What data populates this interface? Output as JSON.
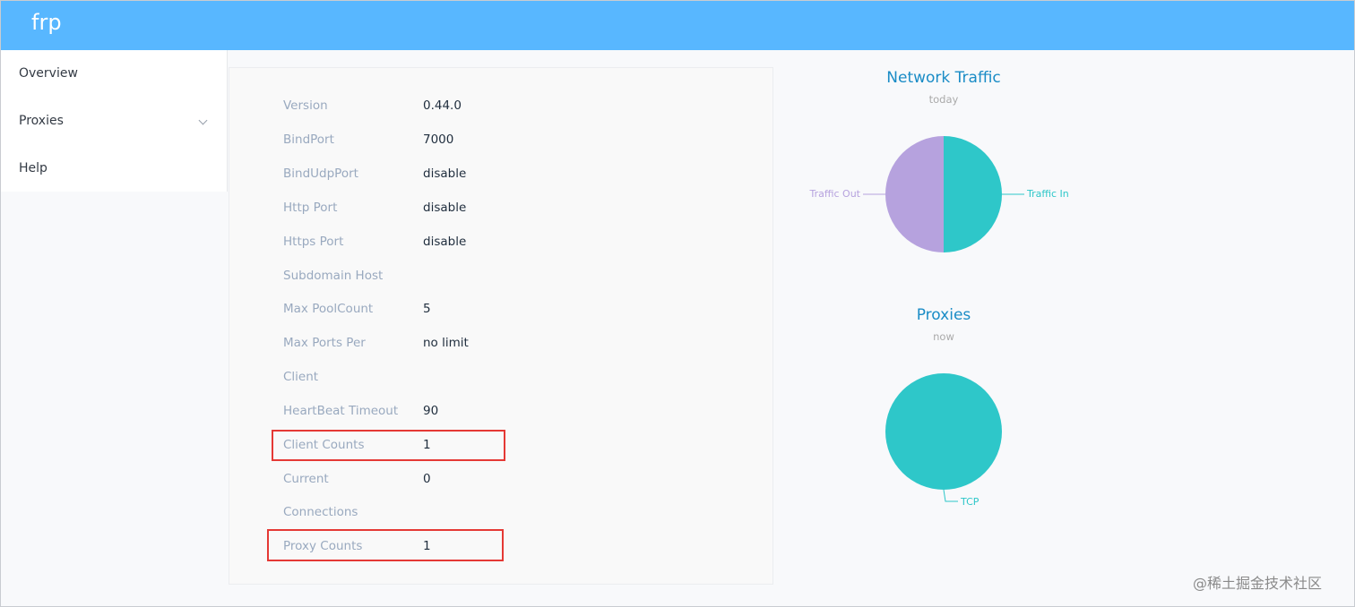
{
  "app": {
    "title": "frp"
  },
  "sidebar": {
    "items": [
      {
        "label": "Overview"
      },
      {
        "label": "Proxies"
      },
      {
        "label": "Help"
      }
    ]
  },
  "server_info": {
    "rows": [
      {
        "label": "Version",
        "value": "0.44.0"
      },
      {
        "label": "BindPort",
        "value": "7000"
      },
      {
        "label": "BindUdpPort",
        "value": "disable"
      },
      {
        "label": "Http Port",
        "value": "disable"
      },
      {
        "label": "Https Port",
        "value": "disable"
      },
      {
        "label": "Subdomain Host",
        "value": ""
      },
      {
        "label": "Max PoolCount",
        "value": "5"
      },
      {
        "label": "Max Ports Per",
        "value": "no limit"
      },
      {
        "label": "Client",
        "value": ""
      },
      {
        "label": "HeartBeat Timeout",
        "value": "90"
      },
      {
        "label": "Client Counts",
        "value": "1"
      },
      {
        "label": "Current",
        "value": "0"
      },
      {
        "label": "Connections",
        "value": ""
      },
      {
        "label": "Proxy Counts",
        "value": "1"
      }
    ]
  },
  "traffic_chart": {
    "title": "Network Traffic",
    "subtitle": "today",
    "slices": [
      {
        "name": "Traffic In",
        "share": 0.5,
        "color": "#2ec7c9"
      },
      {
        "name": "Traffic Out",
        "share": 0.5,
        "color": "#b6a2de"
      }
    ]
  },
  "proxies_chart": {
    "title": "Proxies",
    "subtitle": "now",
    "slices": [
      {
        "name": "TCP",
        "share": 1.0,
        "color": "#2ec7c9"
      }
    ]
  },
  "chart_data": [
    {
      "type": "pie",
      "title": "Network Traffic",
      "subtitle": "today",
      "categories": [
        "Traffic In",
        "Traffic Out"
      ],
      "values": [
        0.5,
        0.5
      ],
      "colors": [
        "#2ec7c9",
        "#b6a2de"
      ]
    },
    {
      "type": "pie",
      "title": "Proxies",
      "subtitle": "now",
      "categories": [
        "TCP"
      ],
      "values": [
        1
      ],
      "colors": [
        "#2ec7c9"
      ]
    }
  ],
  "watermark": {
    "text": "@稀土掘金技术社区"
  }
}
